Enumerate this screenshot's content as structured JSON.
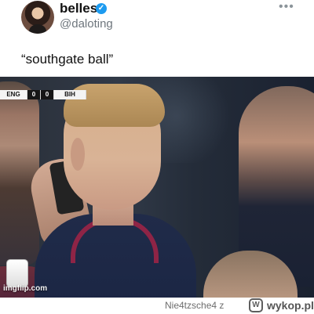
{
  "tweet": {
    "display_name": "belles",
    "handle": "@daloting",
    "text": "“southgate ball”",
    "verified_icon": "verified-badge-icon",
    "more_icon": "more-icon",
    "avatar_icon": "avatar"
  },
  "media": {
    "score": {
      "home": "ENG",
      "home_score": "0",
      "away_score": "0",
      "away": "BIH"
    },
    "watermark": "imgflip.com"
  },
  "footer": {
    "user": "Nie4tzsche4  z",
    "site_icon": "wykop-icon",
    "brand": "wykop.pl"
  },
  "colors": {
    "verified_blue": "#1d9bf0",
    "text_dark": "#111111",
    "muted_gray": "#6e767d",
    "footer_gray": "#6d6d6d"
  }
}
